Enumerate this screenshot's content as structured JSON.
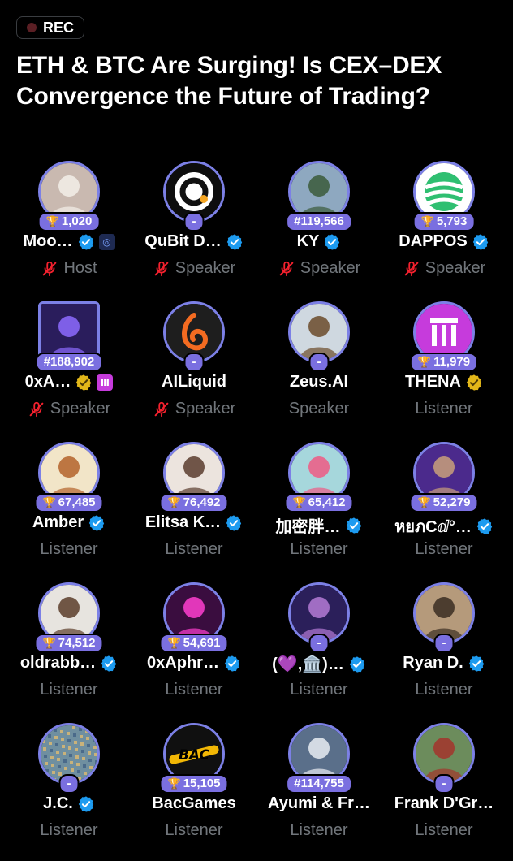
{
  "header": {
    "rec_label": "REC",
    "title": "ETH & BTC Are Surging! Is CEX–DEX Convergence the Future of Trading?"
  },
  "colors": {
    "badge": "#7a6fe0",
    "ring": "#7c80e6",
    "verified": "#1d9bf0",
    "muted_mic": "#f4212e",
    "role_text": "#71767b"
  },
  "participants": [
    {
      "name": "Moo…",
      "badge": "1,020",
      "trophy": true,
      "verified": "blue",
      "extra": "mini",
      "role": "Host",
      "muted": true,
      "avatar": {
        "bg": "#c9b9b0",
        "fg": "#f3efe9",
        "shape": "person"
      }
    },
    {
      "name": "QuBit D…",
      "badge": "-",
      "trophy": false,
      "verified": "blue",
      "role": "Speaker",
      "muted": true,
      "avatar": {
        "bg": "#ffffff",
        "fg": "#111",
        "shape": "ring"
      }
    },
    {
      "name": "KY",
      "badge": "#119,566",
      "trophy": false,
      "verified": "blue",
      "role": "Speaker",
      "muted": true,
      "avatar": {
        "bg": "#8ea8c0",
        "fg": "#3b5a3a",
        "shape": "person"
      }
    },
    {
      "name": "DAPPOS",
      "badge": "5,793",
      "trophy": true,
      "verified": "blue",
      "role": "Speaker",
      "muted": true,
      "avatar": {
        "bg": "#ffffff",
        "fg": "#2fbf71",
        "shape": "globe"
      }
    },
    {
      "name": "0xA…",
      "badge": "#188,902",
      "trophy": false,
      "verified": "gold",
      "extra": "thena",
      "role": "Speaker",
      "muted": true,
      "square": true,
      "avatar": {
        "bg": "#2a1d5c",
        "fg": "#8d6bff",
        "shape": "person"
      }
    },
    {
      "name": "AILiquid",
      "badge": "-",
      "trophy": false,
      "verified": "none",
      "role": "Speaker",
      "muted": true,
      "avatar": {
        "bg": "#1e1e1e",
        "fg": "#f36b21",
        "shape": "swirl"
      }
    },
    {
      "name": "Zeus.AI",
      "badge": "-",
      "trophy": false,
      "verified": "none",
      "role": "Speaker",
      "muted": false,
      "avatar": {
        "bg": "#cfd8e0",
        "fg": "#6b4b2a",
        "shape": "person"
      }
    },
    {
      "name": "THENA",
      "badge": "11,979",
      "trophy": true,
      "verified": "gold",
      "role": "Listener",
      "muted": false,
      "avatar": {
        "bg": "#c63bdc",
        "fg": "#fff",
        "shape": "thena"
      }
    },
    {
      "name": "Amber",
      "badge": "67,485",
      "trophy": true,
      "verified": "blue",
      "role": "Listener",
      "muted": false,
      "avatar": {
        "bg": "#f2e5c8",
        "fg": "#b4632a",
        "shape": "person"
      }
    },
    {
      "name": "Elitsa K…",
      "badge": "76,492",
      "trophy": true,
      "verified": "blue",
      "role": "Listener",
      "muted": false,
      "avatar": {
        "bg": "#ece4de",
        "fg": "#5a3c2e",
        "shape": "person"
      }
    },
    {
      "name": "加密胖…",
      "badge": "65,412",
      "trophy": true,
      "verified": "blue",
      "role": "Listener",
      "muted": false,
      "avatar": {
        "bg": "#a6d7dc",
        "fg": "#ee5b84",
        "shape": "person"
      }
    },
    {
      "name": "หยภCⅆ°…",
      "badge": "52,279",
      "trophy": true,
      "verified": "blue",
      "role": "Listener",
      "muted": false,
      "avatar": {
        "bg": "#4b2a8c",
        "fg": "#c9a07a",
        "shape": "person"
      }
    },
    {
      "name": "oldrabb…",
      "badge": "74,512",
      "trophy": true,
      "verified": "blue",
      "role": "Listener",
      "muted": false,
      "avatar": {
        "bg": "#e7e4df",
        "fg": "#5b3d2a",
        "shape": "person"
      }
    },
    {
      "name": "0xAphr…",
      "badge": "54,691",
      "trophy": true,
      "verified": "blue",
      "role": "Listener",
      "muted": false,
      "avatar": {
        "bg": "#3a0d3f",
        "fg": "#ff3fd0",
        "shape": "person"
      }
    },
    {
      "name": "(💜,🏛️)…",
      "badge": "-",
      "trophy": false,
      "verified": "blue",
      "role": "Listener",
      "muted": false,
      "avatar": {
        "bg": "#2b1f5a",
        "fg": "#b57bd6",
        "shape": "person"
      }
    },
    {
      "name": "Ryan D.",
      "badge": "-",
      "trophy": false,
      "verified": "blue",
      "role": "Listener",
      "muted": false,
      "avatar": {
        "bg": "#b59a7b",
        "fg": "#3a2d22",
        "shape": "person"
      }
    },
    {
      "name": "J.C.",
      "badge": "-",
      "trophy": false,
      "verified": "blue",
      "role": "Listener",
      "muted": false,
      "avatar": {
        "bg": "#6f8fa0",
        "fg": "#c9b27a",
        "shape": "noise"
      }
    },
    {
      "name": "BacGames",
      "badge": "15,105",
      "trophy": true,
      "verified": "none",
      "role": "Listener",
      "muted": false,
      "avatar": {
        "bg": "#101010",
        "fg": "#f2b705",
        "shape": "bac"
      }
    },
    {
      "name": "Ayumi & Fr…",
      "badge": "#114,755",
      "trophy": false,
      "verified": "none",
      "role": "Listener",
      "muted": false,
      "avatar": {
        "bg": "#5a6f8a",
        "fg": "#e9edf2",
        "shape": "person"
      }
    },
    {
      "name": "Frank D'Gr…",
      "badge": "-",
      "trophy": false,
      "verified": "none",
      "role": "Listener",
      "muted": false,
      "avatar": {
        "bg": "#6c8c5c",
        "fg": "#a3342b",
        "shape": "person"
      }
    }
  ]
}
